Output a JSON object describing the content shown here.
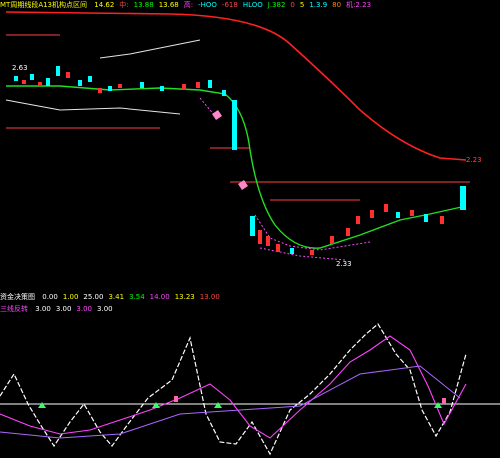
{
  "top_bar": {
    "indicator_name": "MT周期线段A13机构点区间",
    "values": [
      {
        "label": "",
        "value": "14.62",
        "color": "#ffff00"
      },
      {
        "label": "中:",
        "value": "",
        "color": "#ff4444"
      },
      {
        "label": "",
        "value": "13.88",
        "color": "#00ff00"
      },
      {
        "label": "",
        "value": "13.68",
        "color": "#ffff00"
      },
      {
        "label": "高:",
        "value": "",
        "color": "#ff44ff"
      },
      {
        "label": "",
        "value": "-HOO",
        "color": "#00ffff"
      },
      {
        "label": "",
        "value": "-618",
        "color": "#ff4444"
      },
      {
        "label": "",
        "value": "HLOO",
        "color": "#00ffff"
      },
      {
        "label": "",
        "value": "J.382",
        "color": "#00ff00"
      },
      {
        "label": "",
        "value": "0",
        "color": "#ff4444"
      },
      {
        "label": "",
        "value": "5",
        "color": "#ffff00"
      },
      {
        "label": "",
        "value": "1.3.9",
        "color": "#00ffff"
      },
      {
        "label": "",
        "value": "80",
        "color": "#ff8800"
      },
      {
        "label": "机:",
        "value": "2.23",
        "color": "#ff44ff"
      }
    ]
  },
  "main_chart": {
    "price_labels": [
      "2.23",
      "2.63",
      "2.33"
    ]
  },
  "divider_bar": {
    "indicator_name": "资金决策图",
    "values": [
      {
        "label": "",
        "value": "0.00",
        "color": "#ffffff"
      },
      {
        "label": "",
        "value": "1.00",
        "color": "#ffff00"
      },
      {
        "label": "",
        "value": "25.00",
        "color": "#ffffff"
      },
      {
        "label": "",
        "value": "3.41",
        "color": "#ffff00"
      },
      {
        "label": "",
        "value": "3.54",
        "color": "#00ff00"
      },
      {
        "label": "",
        "value": "14.00",
        "color": "#ff44ff"
      },
      {
        "label": "",
        "value": "13.23",
        "color": "#ffff00"
      },
      {
        "label": "",
        "value": "13.00",
        "color": "#ff4444"
      }
    ]
  },
  "lower_bar": {
    "indicator_name": "三线反转",
    "values": [
      {
        "label": "",
        "value": "3.00",
        "color": "#ffffff"
      },
      {
        "label": "",
        "value": "3.00",
        "color": "#ffffff"
      },
      {
        "label": "",
        "value": "3.00",
        "color": "#ff44ff"
      },
      {
        "label": "",
        "value": "3.00",
        "color": "#ffffff"
      }
    ]
  },
  "colors": {
    "background": "#000000",
    "up": "#ff3030",
    "down": "#00ffff",
    "ma_red": "#ff2020",
    "ma_green": "#22dd22",
    "grid": "#8b0000"
  }
}
